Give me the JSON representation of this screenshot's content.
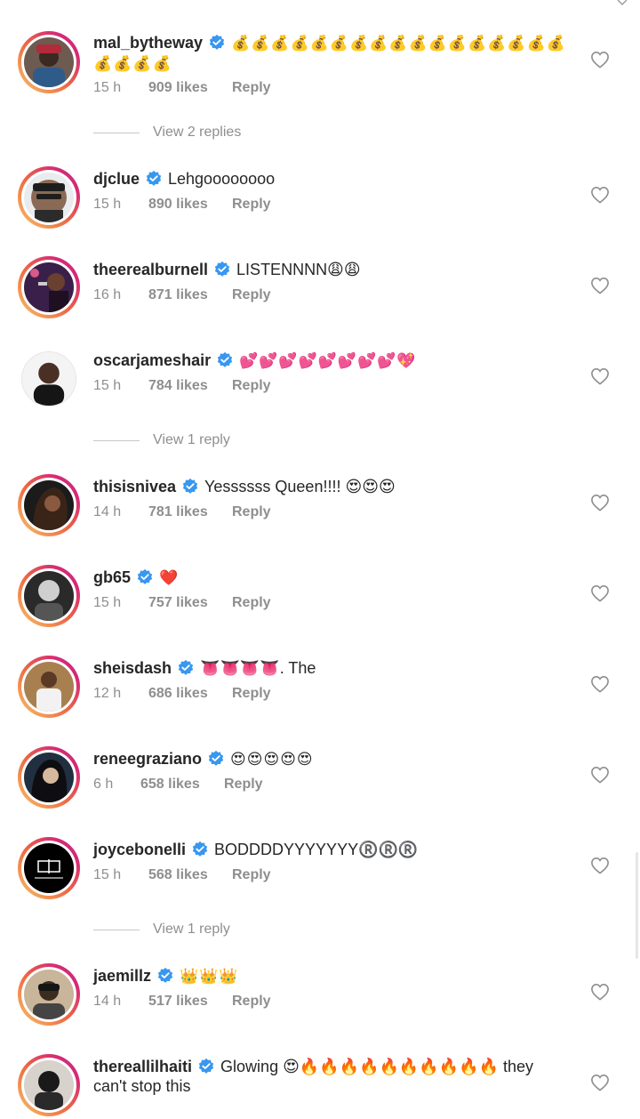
{
  "comments": [
    {
      "username": "mal_bytheway",
      "text_line1": "💰💰💰💰💰💰💰💰💰💰💰💰💰💰💰💰💰",
      "text_line2": "💰💰💰💰",
      "time": "15 h",
      "likes": "909 likes",
      "reply": "Reply",
      "view_replies": "View 2 replies"
    },
    {
      "username": "djclue",
      "text": "Lehgoooooooo",
      "time": "15 h",
      "likes": "890 likes",
      "reply": "Reply"
    },
    {
      "username": "theerealburnell",
      "text": "LISTENNNN😩😩",
      "time": "16 h",
      "likes": "871 likes",
      "reply": "Reply"
    },
    {
      "username": "oscarjameshair",
      "text": "💕💕💕💕💕💕💕💕💖",
      "time": "15 h",
      "likes": "784 likes",
      "reply": "Reply",
      "view_replies": "View 1 reply"
    },
    {
      "username": "thisisnivea",
      "text": "Yessssss Queen!!!! 😍😍😍",
      "time": "14 h",
      "likes": "781 likes",
      "reply": "Reply"
    },
    {
      "username": "gb65",
      "text": "❤️",
      "time": "15 h",
      "likes": "757 likes",
      "reply": "Reply"
    },
    {
      "username": "sheisdash",
      "text": "👅👅👅👅. The",
      "time": "12 h",
      "likes": "686 likes",
      "reply": "Reply"
    },
    {
      "username": "reneegraziano",
      "text": "😍😍😍😍😍",
      "time": "6 h",
      "likes": "658 likes",
      "reply": "Reply"
    },
    {
      "username": "joycebonelli",
      "text": "BODDDDYYYYYYY®️®️®️",
      "time": "15 h",
      "likes": "568 likes",
      "reply": "Reply",
      "view_replies": "View 1 reply"
    },
    {
      "username": "jaemillz",
      "text": "👑👑👑",
      "time": "14 h",
      "likes": "517 likes",
      "reply": "Reply"
    },
    {
      "username": "thereallilhaiti",
      "text_line1": "Glowing 😍🔥🔥🔥🔥🔥🔥🔥🔥🔥🔥 they",
      "text_line2": "can't stop this"
    }
  ],
  "icons": {
    "verified": "verified-badge-icon",
    "like": "heart-outline-icon"
  },
  "colors": {
    "verified_blue": "#3897f0",
    "meta_gray": "#8e8e8e",
    "story_ring": "#d62976"
  }
}
